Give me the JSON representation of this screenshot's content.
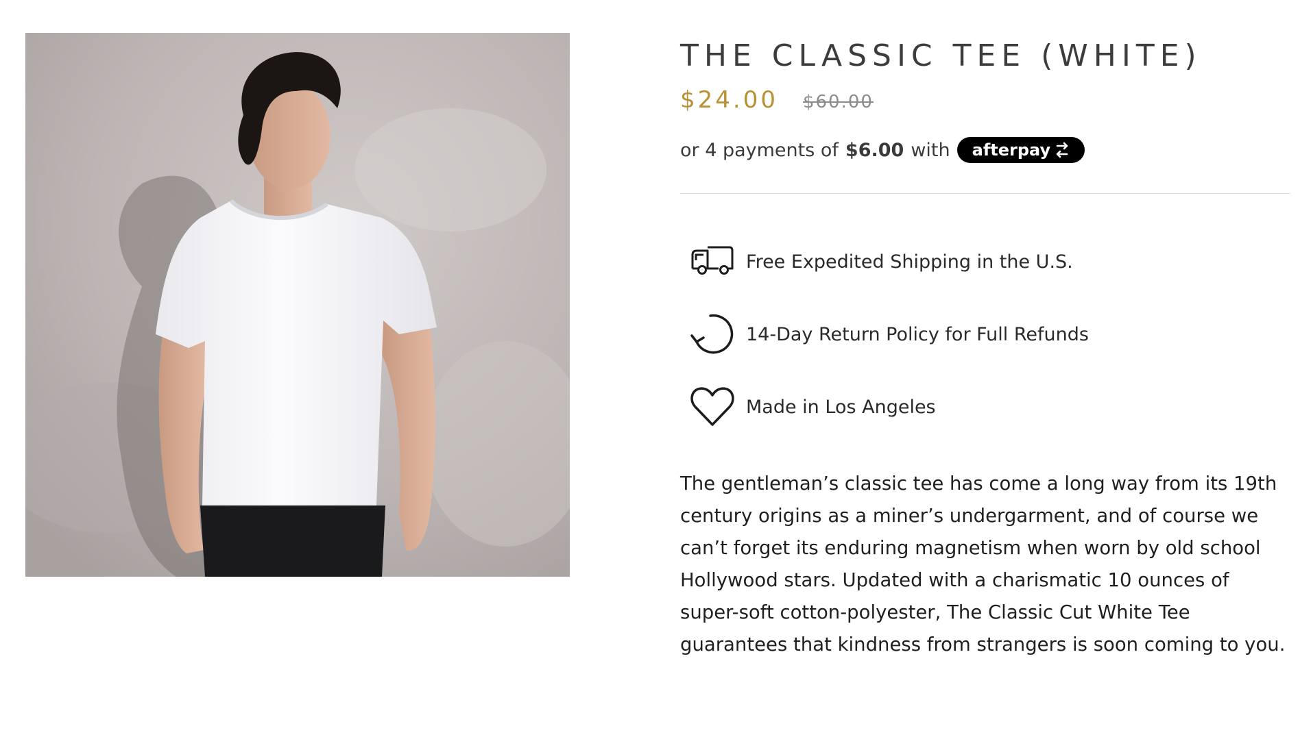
{
  "product": {
    "title": "THE CLASSIC TEE (WHITE)",
    "price_sale": "$24.00",
    "price_compare": "$60.00",
    "image_alt": "Model wearing The Classic Tee in white"
  },
  "afterpay": {
    "prefix": "or 4 payments of",
    "amount": "$6.00",
    "suffix": "with",
    "badge_label": "afterpay"
  },
  "features": [
    {
      "icon": "truck-icon",
      "label": "Free Expedited Shipping in the U.S."
    },
    {
      "icon": "return-arrow-icon",
      "label": "14-Day Return Policy for Full Refunds"
    },
    {
      "icon": "heart-icon",
      "label": "Made in Los Angeles"
    }
  ],
  "description": "The gentleman’s classic tee has come a long way from its 19th century origins as a miner’s undergarment, and of course we can’t forget its enduring magnetism when worn by old school Hollywood stars. Updated with a charismatic 10 ounces of super-soft cotton-polyester, The Classic Cut White Tee guarantees that kindness from strangers is soon coming to you.",
  "colors": {
    "sale_price": "#b89135",
    "title": "#3c3c3c",
    "badge_bg": "#000000"
  }
}
